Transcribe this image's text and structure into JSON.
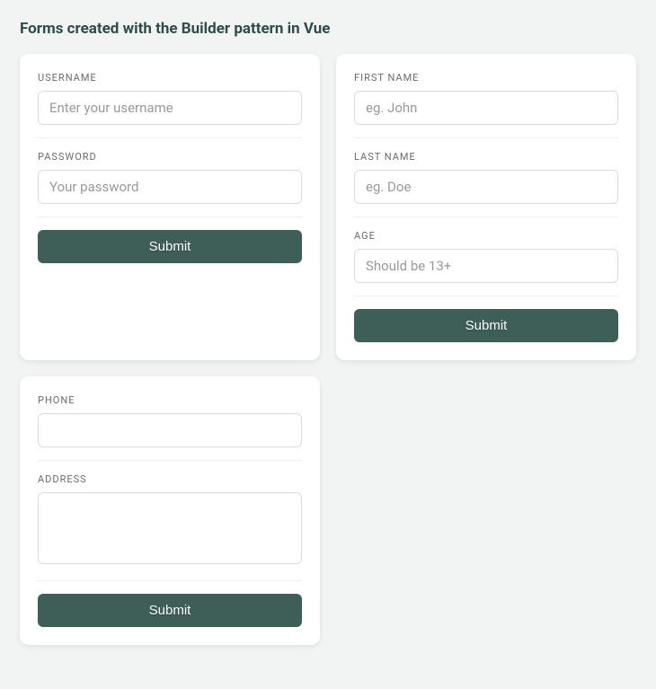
{
  "page": {
    "title": "Forms created with the Builder pattern in Vue"
  },
  "forms": [
    {
      "fields": [
        {
          "label": "USERNAME",
          "placeholder": "Enter your username",
          "type": "text"
        },
        {
          "label": "PASSWORD",
          "placeholder": "Your password",
          "type": "password"
        }
      ],
      "submit_label": "Submit"
    },
    {
      "fields": [
        {
          "label": "FIRST NAME",
          "placeholder": "eg. John",
          "type": "text"
        },
        {
          "label": "LAST NAME",
          "placeholder": "eg. Doe",
          "type": "text"
        },
        {
          "label": "AGE",
          "placeholder": "Should be 13+",
          "type": "text"
        }
      ],
      "submit_label": "Submit"
    },
    {
      "fields": [
        {
          "label": "PHONE",
          "placeholder": "",
          "type": "text"
        },
        {
          "label": "ADDRESS",
          "placeholder": "",
          "type": "textarea"
        }
      ],
      "submit_label": "Submit"
    }
  ]
}
